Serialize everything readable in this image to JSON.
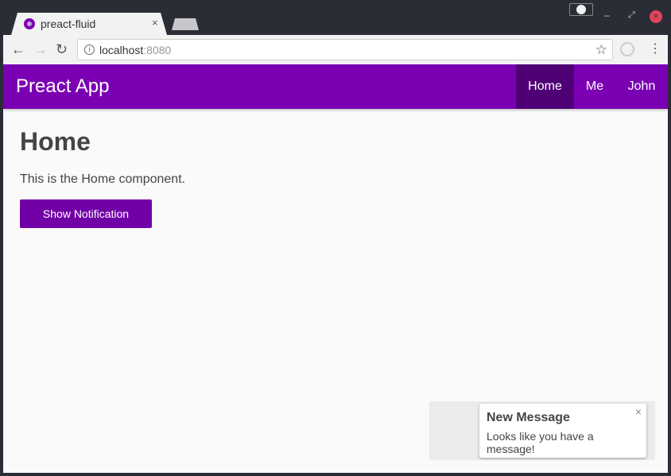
{
  "browser": {
    "tab_title": "preact-fluid",
    "tab_close": "×",
    "url_host": "localhost",
    "url_port": ":8080",
    "back_glyph": "←",
    "forward_glyph": "→",
    "reload_glyph": "↻",
    "star_glyph": "☆",
    "menu_glyph": "⋮",
    "info_glyph": "i",
    "minimize_glyph": "–",
    "restore_glyph": "⤢",
    "close_glyph": "×"
  },
  "app": {
    "title": "Preact App",
    "nav": [
      {
        "label": "Home",
        "active": true
      },
      {
        "label": "Me",
        "active": false
      },
      {
        "label": "John",
        "active": false
      }
    ],
    "accent_color": "#7b00b3"
  },
  "page": {
    "heading": "Home",
    "body": "This is the Home component.",
    "button_label": "Show Notification"
  },
  "toast": {
    "title": "New Message",
    "message": "Looks like you have a message!",
    "close_glyph": "×"
  }
}
